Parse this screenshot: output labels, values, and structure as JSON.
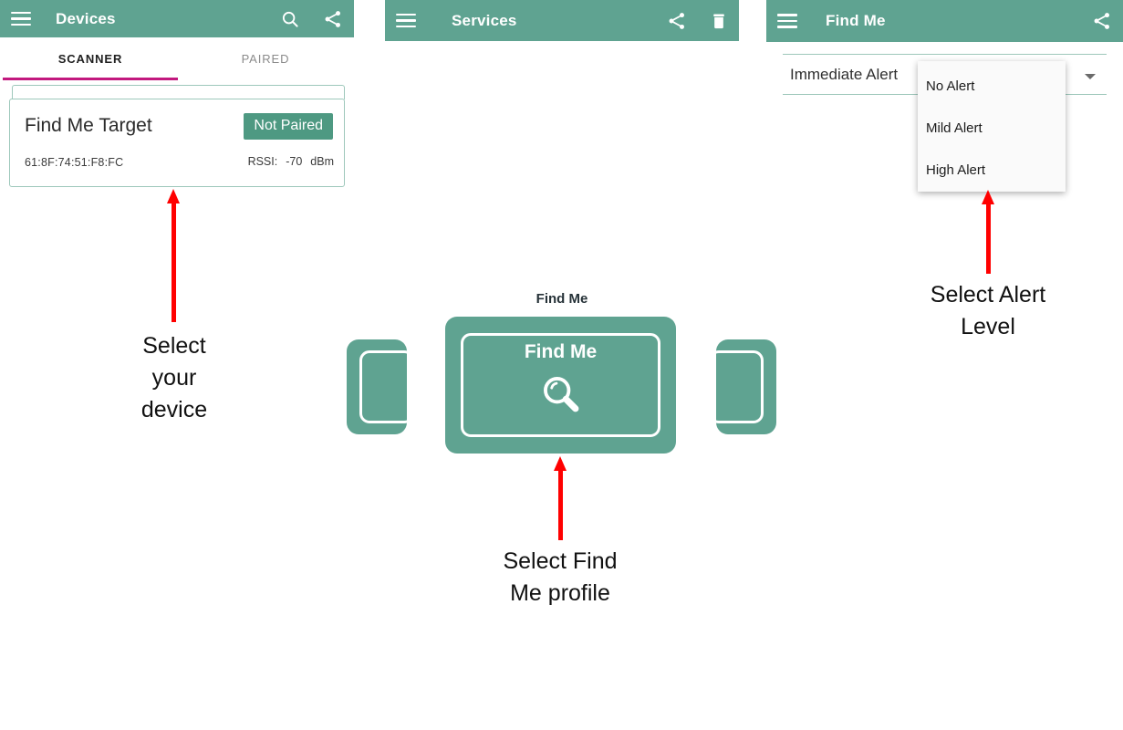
{
  "theme": {
    "primary": "#5FA391",
    "accent": "#C2187E",
    "annotation": "#FF0000",
    "card_border": "#9ec8bb",
    "paired_button_bg": "#4E9982"
  },
  "panels": {
    "devices": {
      "toolbar": {
        "menu_icon": "hamburger-icon",
        "title": "Devices",
        "search_icon": "search-icon",
        "share_icon": "share-icon"
      },
      "tabs": [
        {
          "label": "SCANNER",
          "selected": true
        },
        {
          "label": "PAIRED",
          "selected": false
        }
      ],
      "device": {
        "name": "Find Me Target",
        "address": "61:8F:74:51:F8:FC",
        "pair_status": "Not Paired",
        "rssi_label": "RSSI:",
        "rssi_value": "-70",
        "rssi_unit": "dBm"
      }
    },
    "services": {
      "toolbar": {
        "menu_icon": "hamburger-icon",
        "title": "Services",
        "share_icon": "share-icon",
        "delete_icon": "trash-icon"
      },
      "profile_title": "Find Me",
      "card_label": "Find Me",
      "card_icon": "magnifier-icon"
    },
    "findme": {
      "toolbar": {
        "menu_icon": "hamburger-icon",
        "title": "Find Me",
        "share_icon": "share-icon"
      },
      "spinner": {
        "value": "Immediate Alert",
        "caret_icon": "chevron-down-icon"
      },
      "dropdown_options": [
        "No Alert",
        "Mild Alert",
        "High Alert"
      ]
    }
  },
  "annotations": [
    {
      "text": "Select\nyour\ndevice"
    },
    {
      "text": "Select Find\nMe profile"
    },
    {
      "text": "Select Alert\nLevel"
    }
  ]
}
